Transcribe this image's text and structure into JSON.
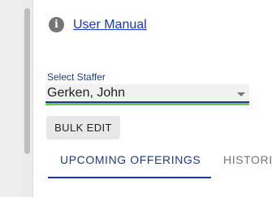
{
  "help": {
    "icon": "info-icon",
    "icon_glyph": "i",
    "link_label": "User Manual",
    "link_color": "#1a36c4"
  },
  "staffer_select": {
    "label": "Select Staffer",
    "selected": "Gerken, John",
    "icon": "chevron-down-icon"
  },
  "actions": {
    "bulk_edit_label": "BULK EDIT"
  },
  "tabs": [
    {
      "label": "UPCOMING OFFERINGS",
      "active": true
    },
    {
      "label": "HISTORI",
      "active": false
    }
  ],
  "colors": {
    "primary": "#1f3a8a",
    "focus": "#5fc33a",
    "muted": "#757575"
  }
}
